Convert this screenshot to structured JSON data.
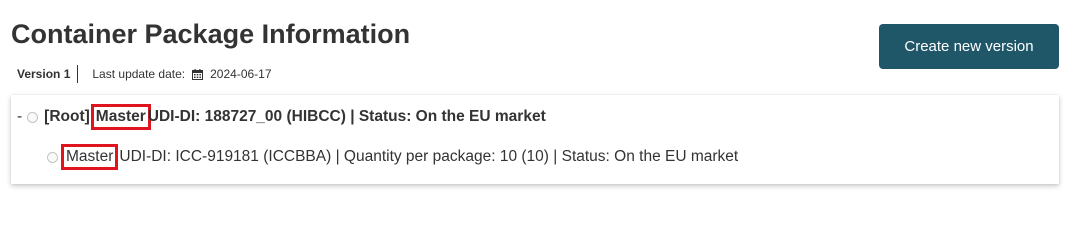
{
  "header": {
    "title": "Container Package Information",
    "version_label": "Version 1",
    "last_update_label": "Last update date:",
    "last_update_date": "2024-06-17",
    "create_button_label": "Create new version"
  },
  "tree": {
    "root": {
      "expander": "-",
      "prefix": "[Root]",
      "badge": "Master",
      "text": "UDI-DI: 188727_00 (HIBCC) | Status: On the EU market"
    },
    "children": [
      {
        "badge": "Master",
        "text": "UDI-DI: ICC-919181 (ICCBBA) | Quantity per package: 10 (10) | Status: On the EU market"
      }
    ]
  },
  "colors": {
    "button_bg": "#1f5668",
    "highlight": "#e0141e",
    "text": "#333333"
  },
  "icons": {
    "calendar": "calendar-icon"
  }
}
